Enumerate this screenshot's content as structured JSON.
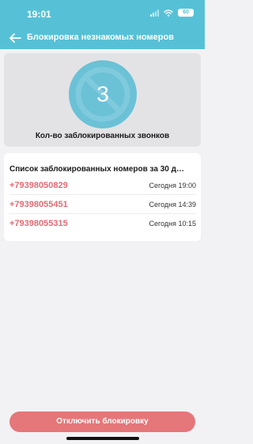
{
  "status_bar": {
    "time": "19:01",
    "battery": "60"
  },
  "nav": {
    "title": "Блокировка незнакомых номеров"
  },
  "counter": {
    "value": "3",
    "label": "Кол-во заблокированных звонков"
  },
  "blocked_list": {
    "title": "Список заблокированных номеров за 30 д…",
    "items": [
      {
        "number": "+79398050829",
        "time": "Сегодня 19:00"
      },
      {
        "number": "+79398055451",
        "time": "Сегодня 14:39"
      },
      {
        "number": "+79398055315",
        "time": "Сегодня 10:15"
      }
    ]
  },
  "action": {
    "disable_label": "Отключить блокировку"
  },
  "colors": {
    "accent": "#56c1d6",
    "number": "#e26b74",
    "button": "#e57679"
  },
  "icons": [
    "back-arrow-icon",
    "signal-icon",
    "wifi-icon",
    "battery-icon",
    "blocked-call-icon"
  ]
}
